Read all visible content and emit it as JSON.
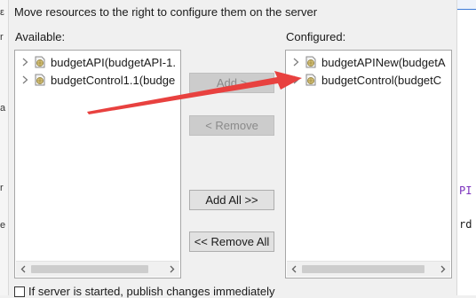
{
  "dialog": {
    "instruction": "Move resources to the right to configure them on the server",
    "available_label": "Available:",
    "configured_label": "Configured:"
  },
  "available": {
    "items": [
      {
        "label": "budgetAPI(budgetAPI-1."
      },
      {
        "label": "budgetControl1.1(budge"
      }
    ]
  },
  "configured": {
    "items": [
      {
        "label": "budgetAPINew(budgetA"
      },
      {
        "label": "budgetControl(budgetC"
      }
    ]
  },
  "buttons": {
    "add": "Add >",
    "remove": "< Remove",
    "add_all": "Add All >>",
    "remove_all": "<< Remove All"
  },
  "footer": {
    "publish_checkbox_label": "If server is started, publish changes immediately",
    "publish_checked": false
  },
  "background": {
    "right_fragments": [
      "PI",
      "rd"
    ]
  },
  "colors": {
    "annotation_arrow": "#e8413f",
    "accent": "#3d7bd9",
    "code_keyword": "#7a2fbd"
  },
  "icons": {
    "tree_expand": "chevron-right-icon",
    "project": "web-project-icon",
    "annotation": "red-arrow-icon"
  }
}
